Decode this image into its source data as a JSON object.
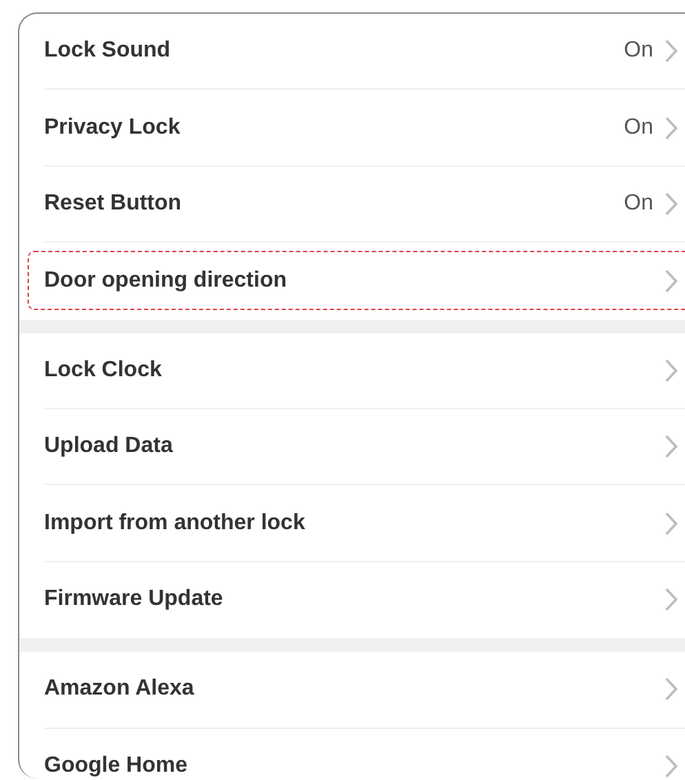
{
  "sections": [
    {
      "rows": [
        {
          "label": "Lock Sound",
          "value": "On",
          "highlighted": false
        },
        {
          "label": "Privacy Lock",
          "value": "On",
          "highlighted": false
        },
        {
          "label": "Reset Button",
          "value": "On",
          "highlighted": false
        },
        {
          "label": "Door opening direction",
          "highlighted": true
        }
      ]
    },
    {
      "rows": [
        {
          "label": "Lock Clock",
          "highlighted": false
        },
        {
          "label": "Upload Data",
          "highlighted": false
        },
        {
          "label": "Import from another lock",
          "highlighted": false
        },
        {
          "label": "Firmware Update",
          "highlighted": false
        }
      ]
    },
    {
      "rows": [
        {
          "label": "Amazon Alexa",
          "highlighted": false
        },
        {
          "label": "Google Home",
          "highlighted": false
        }
      ]
    }
  ]
}
